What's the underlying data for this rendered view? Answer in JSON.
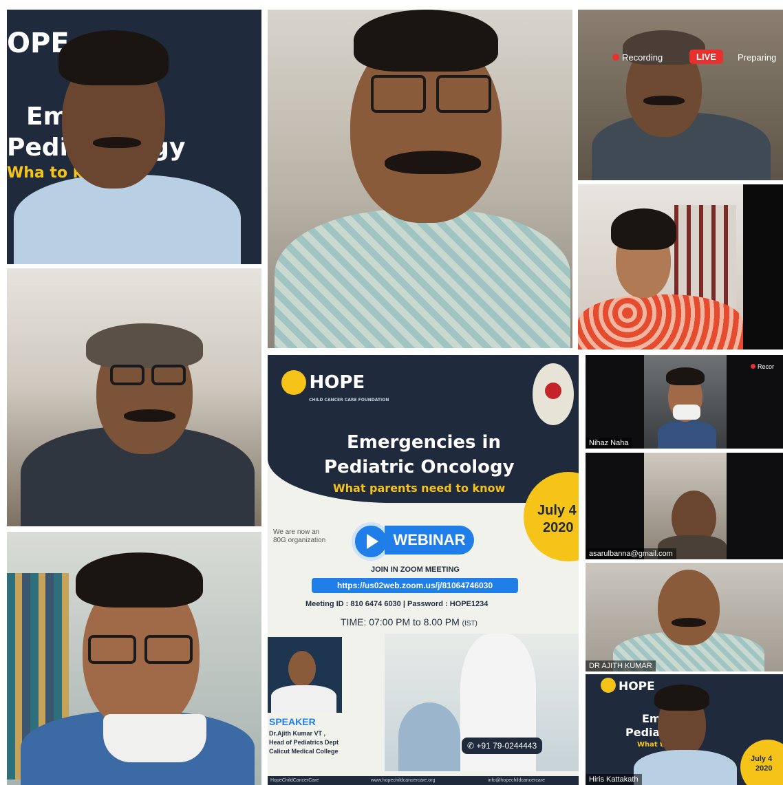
{
  "tiles": {
    "t1": {
      "banner_logo": "OPE",
      "banner_line1": "Em     ies in",
      "banner_line2": "Pedi      ncology",
      "banner_line3": "Wha          to know"
    },
    "t3": {
      "recording": "Recording",
      "live": "LIVE",
      "preparing": "Preparing"
    },
    "t9": {
      "name": "Nihaz Naha",
      "rec": "Recor"
    },
    "t10": {
      "name": "asarulbanna@gmail.com"
    },
    "t11": {
      "name": "DR AJITH KUMAR"
    },
    "t12": {
      "logo": "HOPE",
      "line1": "Em      es in",
      "line2": "Pedia      cology",
      "line3": "What       to know",
      "date": "July 4",
      "year": "2020",
      "name": "Hiris Kattakath"
    }
  },
  "poster": {
    "logo": "HOPE",
    "logo_sub": "CHILD CANCER CARE FOUNDATION",
    "title_line1": "Emergencies in",
    "title_line2": "Pediatric Oncology",
    "subtitle": "What parents need to know",
    "date_month": "July 4",
    "date_year": "2020",
    "ngo_line1": "We are now an",
    "ngo_line2": "80G organization",
    "webinar": "WEBINAR",
    "join": "JOIN IN ZOOM MEETING",
    "link": "https://us02web.zoom.us/j/81064746030",
    "meeting": "Meeting ID : 810 6474 6030 | Password : HOPE1234",
    "time": "TIME: 07:00 PM to 8.00 PM",
    "time_zone": "(IST)",
    "speaker_label": "SPEAKER",
    "speaker_name": "Dr.Ajith Kumar VT ,",
    "speaker_role": "Head of Pediatrics Dept",
    "speaker_college": "Calicut Medical College",
    "phone": "+91 79-0244443",
    "footer_left": "HopeChildCancerCare",
    "footer_mid": "www.hopechildcancercare.org",
    "footer_right": "info@hopechildcancercare"
  },
  "colors": {
    "navy": "#1f2b3d",
    "yellow": "#f6c319",
    "blue": "#1f7ee8",
    "live_red": "#e8312f"
  }
}
